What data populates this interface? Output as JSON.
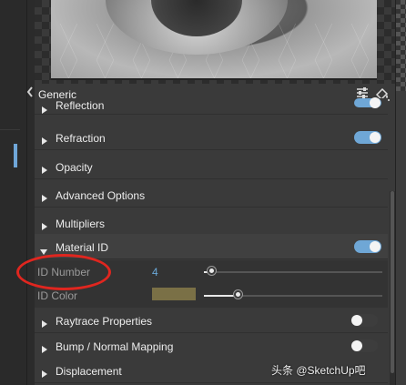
{
  "panel": {
    "title": "Generic",
    "sections": [
      {
        "label": "Reflection",
        "toggle": "on"
      },
      {
        "label": "Refraction",
        "toggle": "on"
      },
      {
        "label": "Opacity"
      },
      {
        "label": "Advanced Options"
      },
      {
        "label": "Multipliers"
      },
      {
        "label": "Material ID",
        "toggle": "on",
        "expanded": true
      },
      {
        "label": "Raytrace Properties",
        "toggle": "off"
      },
      {
        "label": "Bump / Normal Mapping",
        "toggle": "off"
      },
      {
        "label": "Displacement"
      }
    ],
    "material_id": {
      "id_number_label": "ID Number",
      "id_number_value": "4",
      "id_number_slider": 0.05,
      "id_color_label": "ID Color",
      "id_color": "#7a7046",
      "id_color_slider": 0.2
    }
  },
  "colors": {
    "toggle_on": "#6fa7d6",
    "accent_value": "#6aa8d8",
    "highlight_ring": "#e0261f"
  },
  "watermark": "头条 @SketchUp吧"
}
